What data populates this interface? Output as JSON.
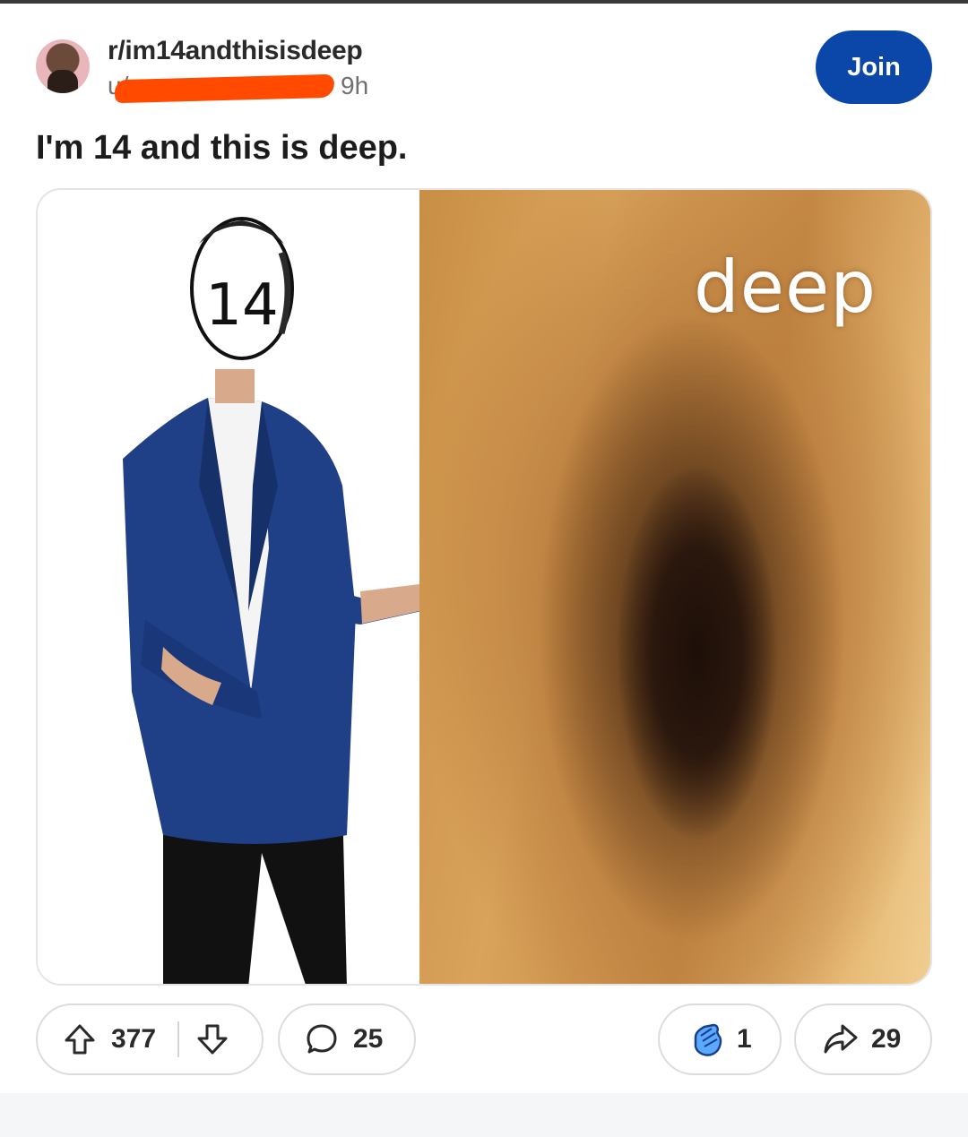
{
  "post": {
    "subreddit": "r/im14andthisisdeep",
    "user_prefix": "u/",
    "time": "9h",
    "join_label": "Join",
    "title": "I'm 14 and this is deep.",
    "image": {
      "face_label": "14",
      "overlay_text": "deep"
    }
  },
  "actions": {
    "upvotes": "377",
    "comments": "25",
    "awards": "1",
    "shares": "29"
  },
  "colors": {
    "join_bg": "#0a47a8",
    "redaction": "#ff4a00"
  }
}
